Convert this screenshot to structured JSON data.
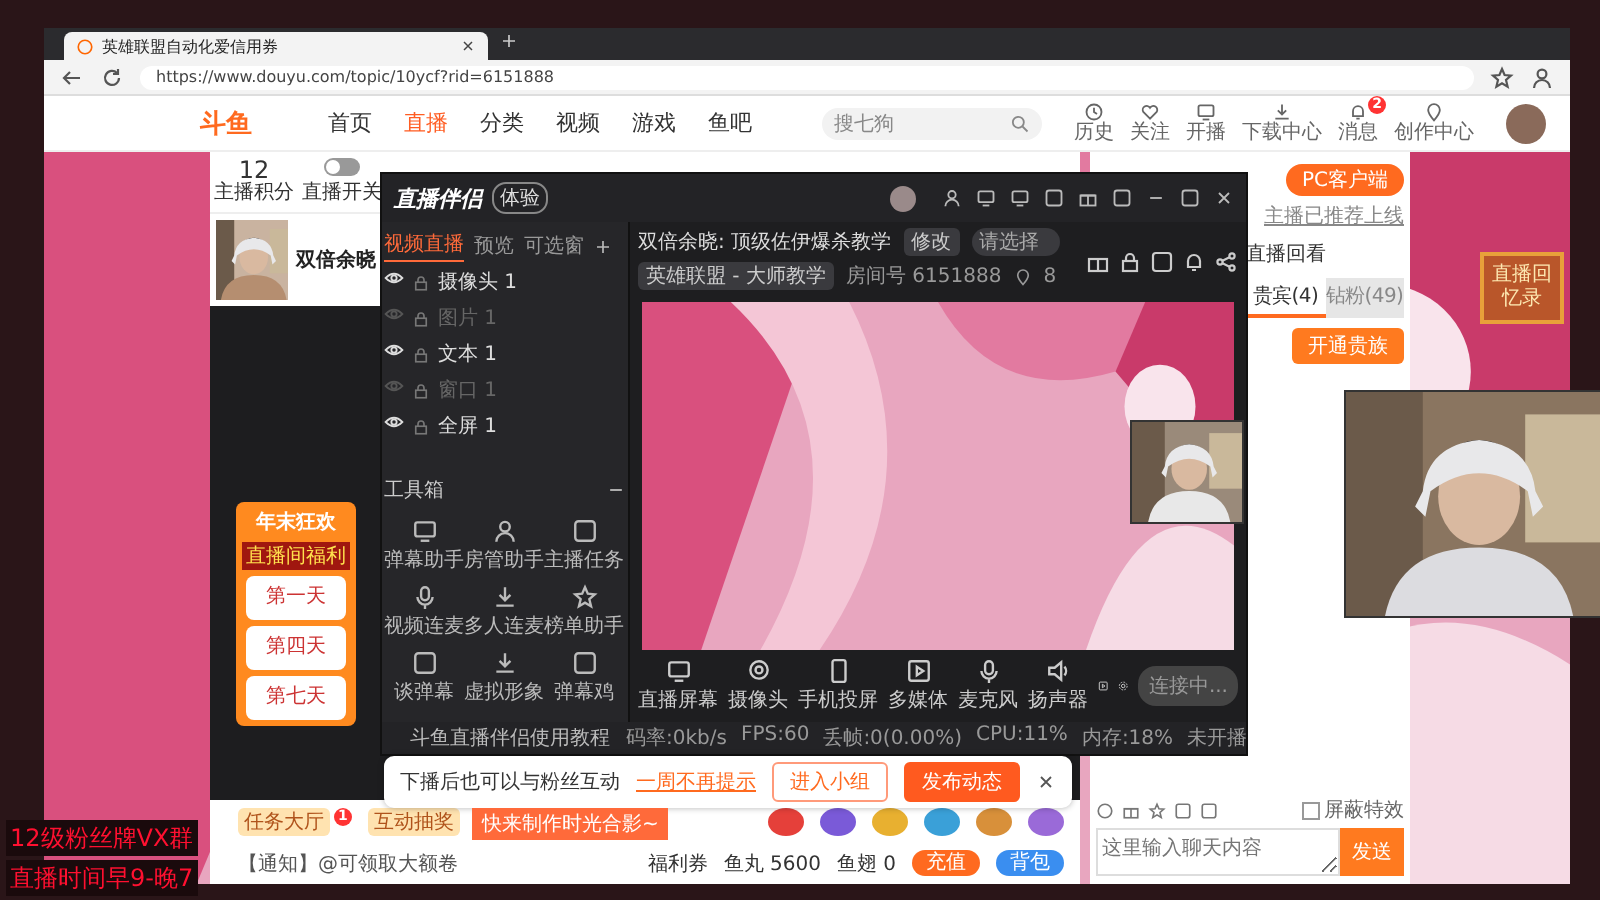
{
  "browser": {
    "tab_title": "英雄联盟自动化爱信用券",
    "url": "https://www.douyu.com/topic/10ycf?rid=6151888"
  },
  "site_header": {
    "logo": "斗鱼",
    "nav": [
      {
        "label": "首页",
        "selected": false
      },
      {
        "label": "直播",
        "selected": true
      },
      {
        "label": "分类",
        "selected": false
      },
      {
        "label": "视频",
        "selected": false
      },
      {
        "label": "游戏",
        "selected": false
      },
      {
        "label": "鱼吧",
        "selected": false
      }
    ],
    "search": {
      "placeholder": "搜七狗"
    },
    "user_links": [
      "历史",
      "关注",
      "开播",
      "下载中心",
      "消息",
      "创作中心"
    ],
    "message_badge": "2"
  },
  "streamer": {
    "score": "12",
    "score_label": "主播积分",
    "live_switch": {
      "label": "直播开关",
      "on": false
    },
    "name": "双倍余晓"
  },
  "promo": {
    "title": "年末狂欢",
    "subtitle": "直播间福利",
    "days": [
      "第一天",
      "第四天",
      "第七天"
    ]
  },
  "companion_app": {
    "title": "直播伴侣",
    "badge": "体验",
    "scene_tabs": [
      {
        "label": "视频直播",
        "selected": true
      },
      {
        "label": "预览",
        "selected": false
      },
      {
        "label": "可选窗",
        "selected": false
      }
    ],
    "sources": [
      {
        "name": "摄像头 1",
        "visible": true
      },
      {
        "name": "图片 1",
        "visible": false
      },
      {
        "name": "文本 1",
        "visible": true
      },
      {
        "name": "窗口 1",
        "visible": false
      },
      {
        "name": "全屏 1",
        "visible": true
      }
    ],
    "toolbox_title": "工具箱",
    "tools": [
      "弹幕助手",
      "房管助手",
      "主播任务",
      "视频连麦",
      "多人连麦",
      "榜单助手",
      "谈弹幕",
      "虚拟形象",
      "弹幕鸡"
    ],
    "stream_title": "双倍余晓: 顶级佐伊爆杀教学",
    "edit_button": "修改",
    "category_select": "请选择",
    "category": "英雄联盟 - 大师教学",
    "room_id": "房间号 6151888",
    "hot": "8",
    "controls": [
      "直播屏幕",
      "摄像头",
      "手机投屏",
      "多媒体",
      "麦克风",
      "扬声器"
    ],
    "start_button": "连接中...",
    "tutorial": "斗鱼直播伴侣使用教程",
    "stats": [
      "码率:0kb/s",
      "FPS:60",
      "丢帧:0(0.00%)",
      "CPU:11%",
      "内存:18%",
      "未开播"
    ]
  },
  "notice": {
    "text": "下播后也可以与粉丝互动",
    "dismiss_link": "一周不再提示",
    "buttons": [
      {
        "label": "进入小组",
        "kind": "outline"
      },
      {
        "label": "发布动态",
        "kind": "filled"
      }
    ]
  },
  "tip": "快来制作时光合影~",
  "right_panel": {
    "client_button": "PC客户端",
    "client_note": "主播已推荐上线",
    "replay": "直播回看",
    "tabs": [
      {
        "label": "贵宾(4)",
        "selected": true
      },
      {
        "label": "钻粉(49)",
        "selected": false
      }
    ],
    "vip_button": "开通贵族"
  },
  "memory_card": "直播回忆录",
  "bottom_bar": {
    "activities": [
      "任务大厅",
      "互动抽奖"
    ],
    "activity_badge": "1",
    "notice": "【通知】@可领取大额卷",
    "coupon": "福利券",
    "fish_balls": "鱼丸 5600",
    "fins": "鱼翅 0",
    "recharge": "充值",
    "backpack": "背包"
  },
  "chat": {
    "block_effects": {
      "label": "屏蔽特效",
      "checked": false
    },
    "placeholder": "这里输入聊天内容",
    "send": "发送"
  },
  "overlay": [
    "12级粉丝牌VX群",
    "直播时间早9-晚7"
  ]
}
